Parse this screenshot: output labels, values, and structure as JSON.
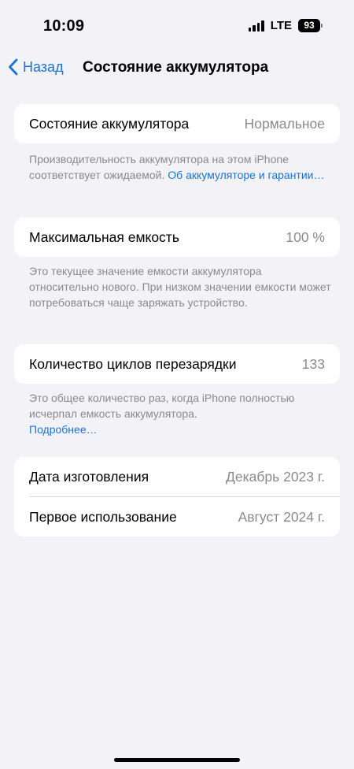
{
  "status_bar": {
    "time": "10:09",
    "network": "LTE",
    "battery_level": "93"
  },
  "nav": {
    "back_label": "Назад",
    "title": "Состояние аккумулятора"
  },
  "battery_health": {
    "label": "Состояние аккумулятора",
    "value": "Нормальное",
    "footnote_text": "Производительность аккумулятора на этом iPhone соответствует ожидаемой. ",
    "footnote_link": "Об аккумуляторе и гарантии…"
  },
  "max_capacity": {
    "label": "Максимальная емкость",
    "value": "100 %",
    "footnote_text": "Это текущее значение емкости аккумулятора относительно нового. При низком значении емкости может потребоваться чаще заряжать устройство."
  },
  "cycle_count": {
    "label": "Количество циклов перезарядки",
    "value": "133",
    "footnote_text": "Это общее количество раз, когда iPhone полностью исчерпал емкость аккумулятора.",
    "footnote_link": "Подробнее…"
  },
  "dates": {
    "manufacture_label": "Дата изготовления",
    "manufacture_value": "Декабрь 2023 г.",
    "first_use_label": "Первое использование",
    "first_use_value": "Август 2024 г."
  },
  "colors": {
    "background": "#f2f2f7",
    "accent": "#1a73d9",
    "secondary_text": "#8a8a8e"
  }
}
